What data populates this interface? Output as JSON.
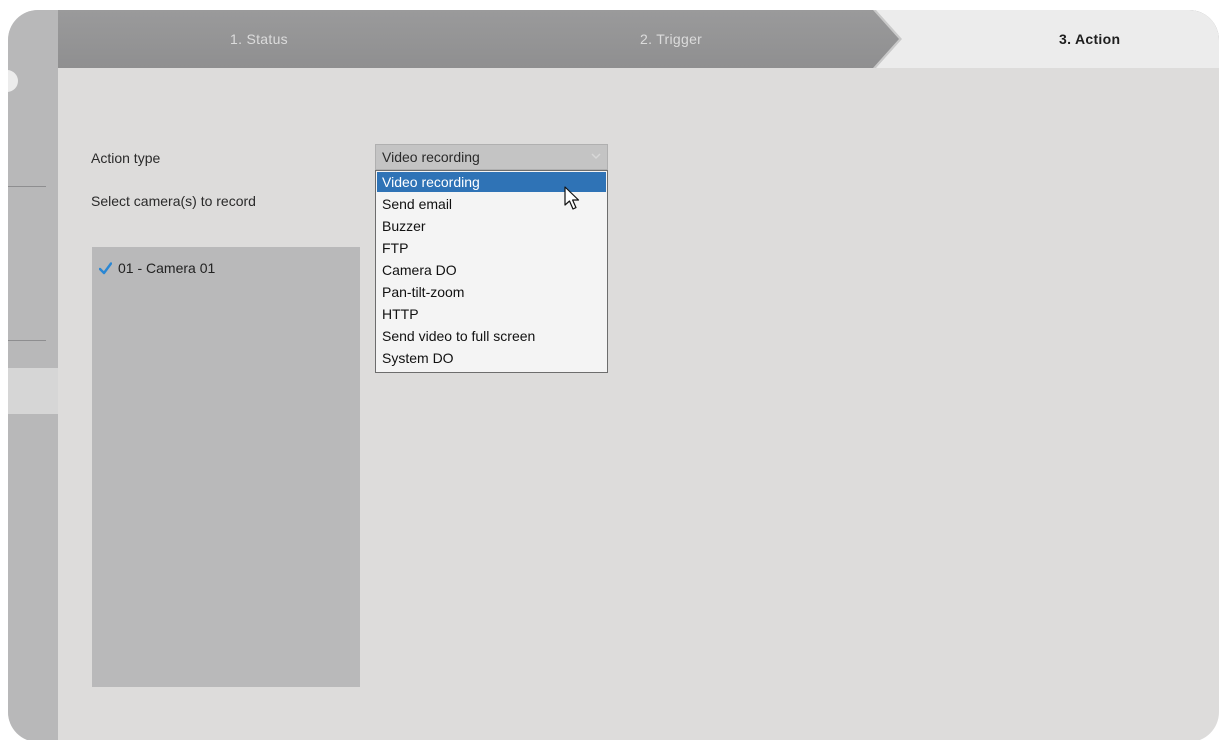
{
  "steps": [
    {
      "label": "1. Status"
    },
    {
      "label": "2. Trigger"
    },
    {
      "label": "3. Action"
    }
  ],
  "form": {
    "action_type_label": "Action type",
    "select_cameras_label": "Select camera(s) to record",
    "action_select_value": "Video recording"
  },
  "action_options": [
    "Video recording",
    "Send email",
    "Buzzer",
    "FTP",
    "Camera DO",
    "Pan-tilt-zoom",
    "HTTP",
    "Send video to full screen",
    "System DO"
  ],
  "cameras": [
    {
      "label": "01 - Camera 01",
      "checked": true
    }
  ],
  "colors": {
    "selected_option": "#2f73b6",
    "checkmark": "#2a87d4"
  }
}
